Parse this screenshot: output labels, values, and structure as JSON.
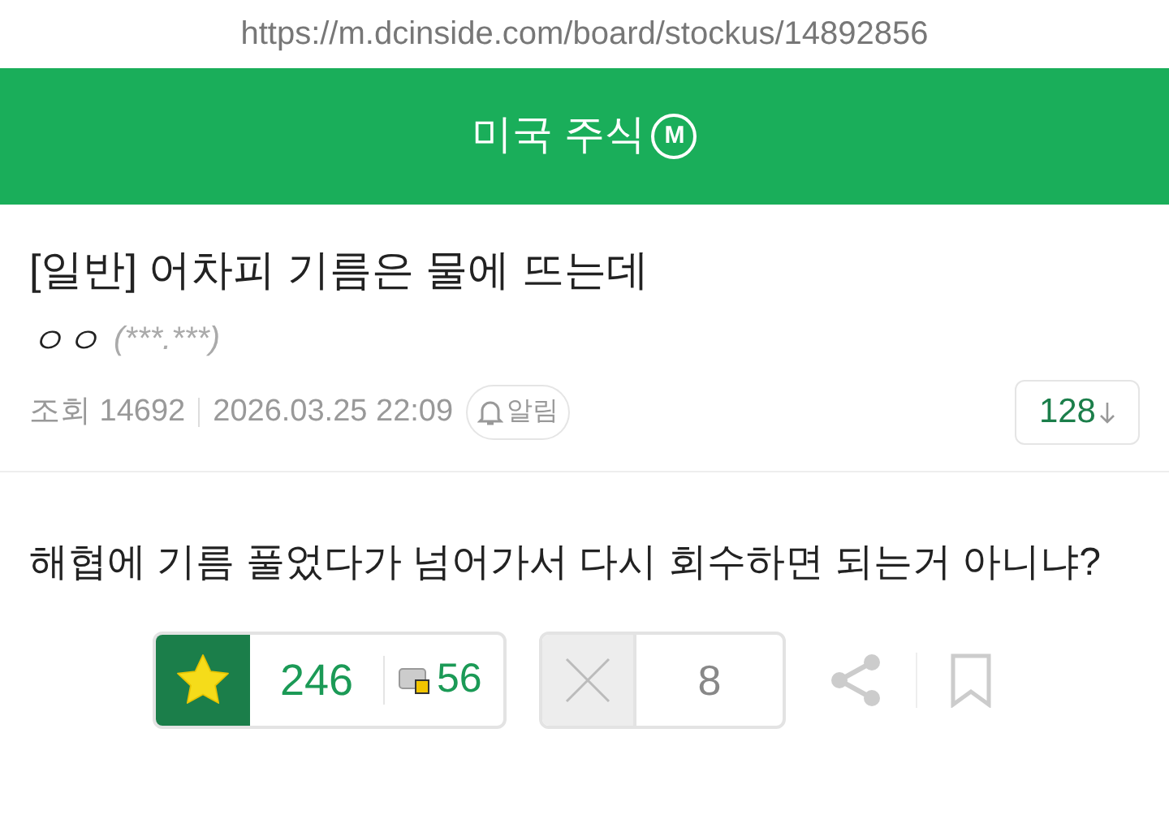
{
  "address_bar": {
    "url": "https://m.dcinside.com/board/stockus/14892856"
  },
  "header": {
    "title": "미국 주식",
    "badge": "M"
  },
  "post": {
    "title": "[일반] 어차피 기름은 물에 뜨는데",
    "author": "ㅇㅇ",
    "ip": "(***.***)",
    "views": "조회 14692",
    "date": "2026.03.25 22:09",
    "alert": "알림",
    "comments": "128",
    "body": "해협에 기름 풀었다가 넘어가서 다시 회수하면 되는거 아니냐?"
  },
  "votes": {
    "up": "246",
    "fixed_up": "56",
    "down": "8"
  }
}
